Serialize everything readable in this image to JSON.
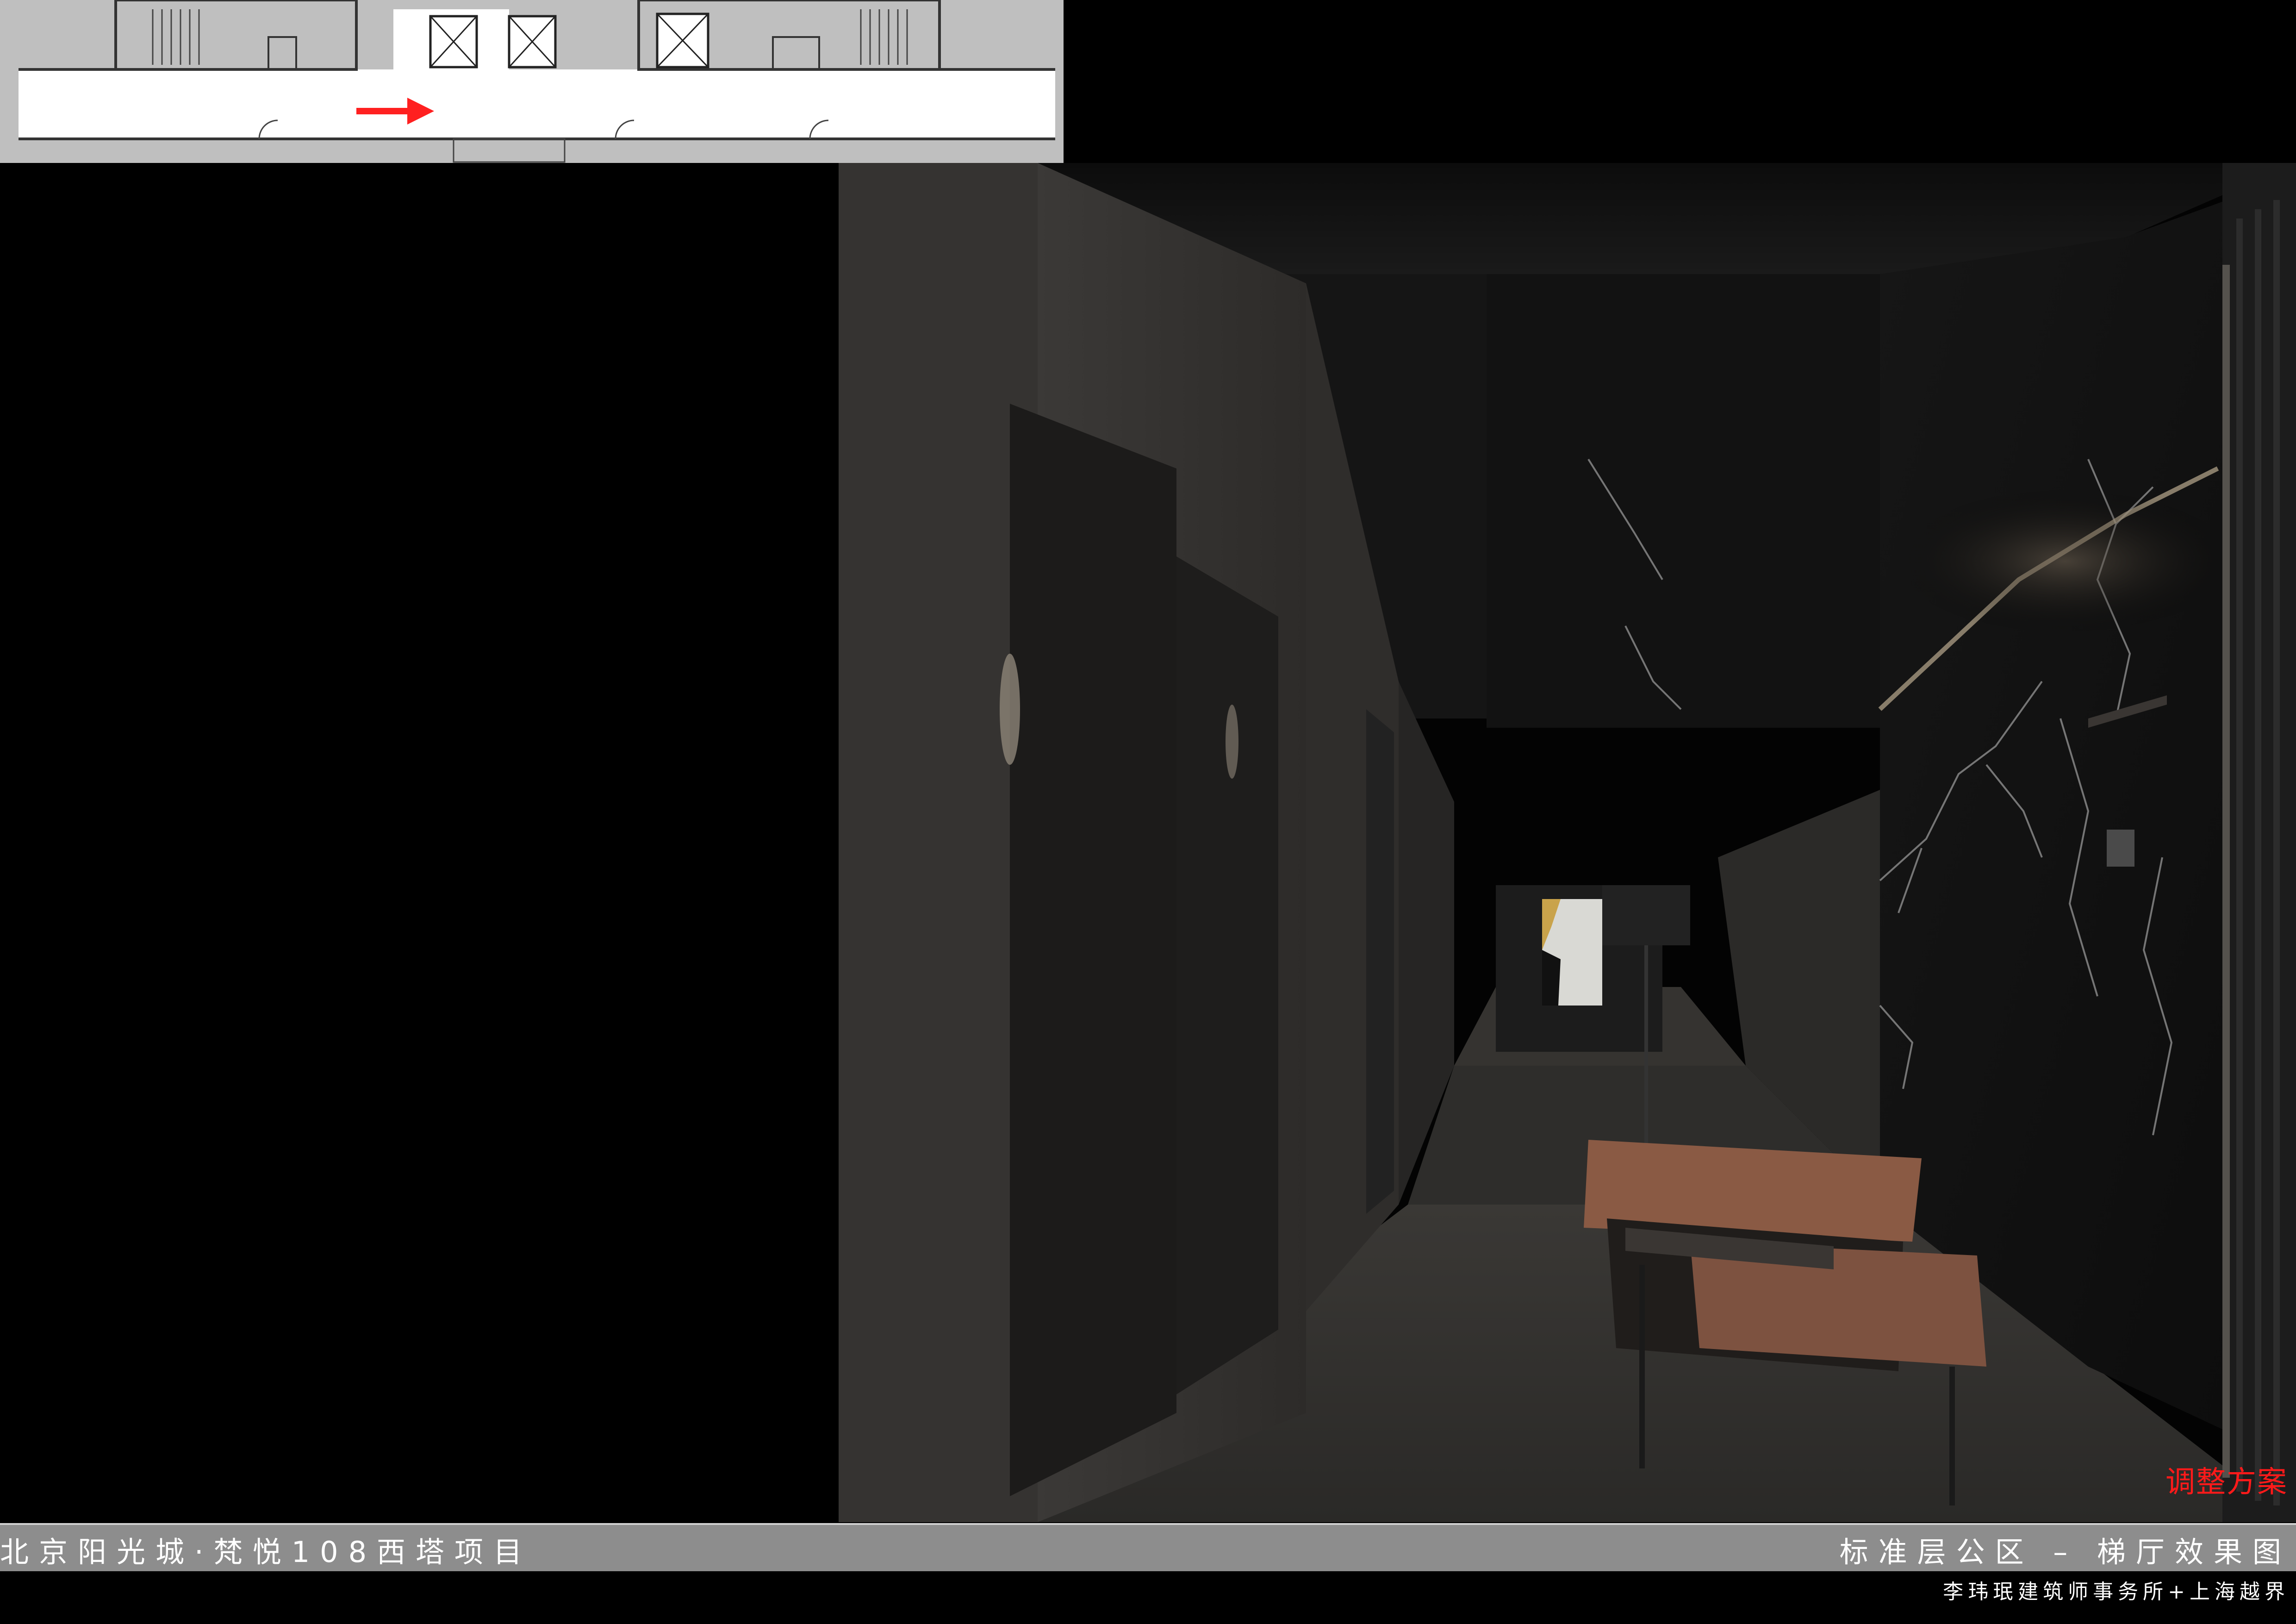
{
  "note": "调整方案",
  "footer": {
    "project_title": "北京阳光城·梵悦108西塔项目",
    "sheet_title": "标准层公区 – 梯厅效果图",
    "firm": "李玮珉建筑师事务所+上海越界"
  },
  "colors": {
    "title_bar": "#8d8d8d",
    "note_text": "#ff1a1a",
    "arrow": "#ff2020",
    "bench_leather": "#8a5a44",
    "marble": "#141414"
  },
  "plan": {
    "icon": "plan-view-direction-arrow"
  }
}
